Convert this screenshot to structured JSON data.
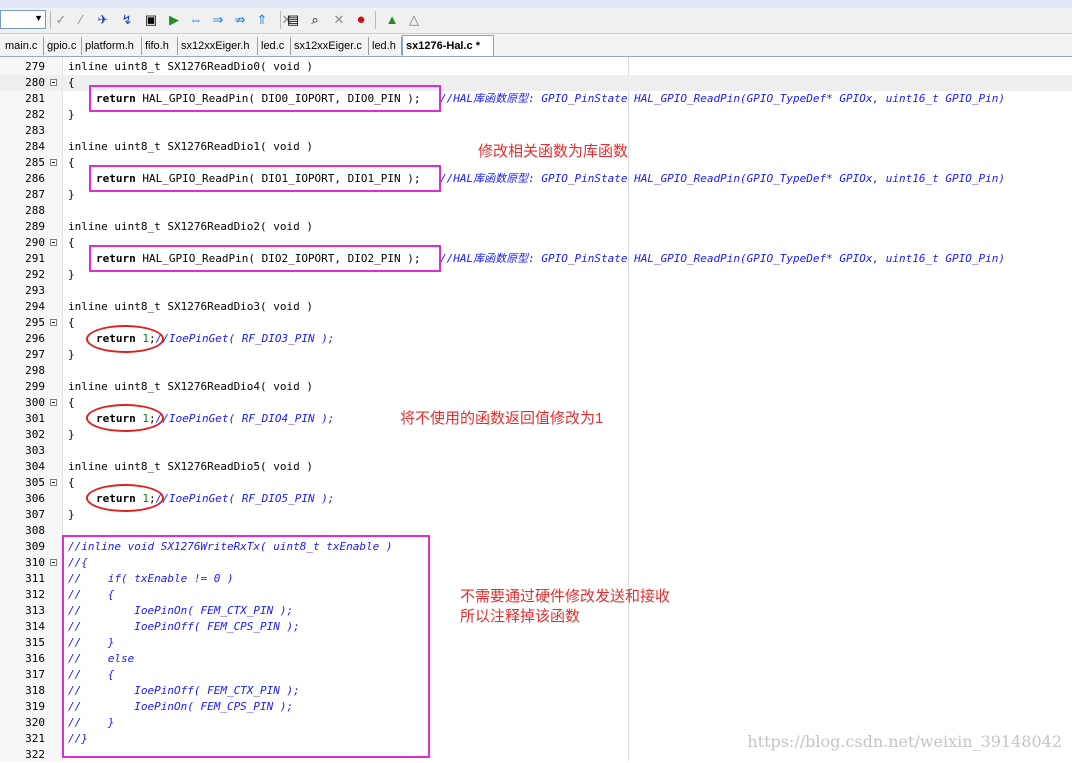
{
  "toolbar": {
    "icons": [
      "pointer-icon",
      "wand-icon",
      "bookmark-icon",
      "bookmark-next-icon",
      "bookmark-clear-icon",
      "build-icon",
      "debug-icon",
      "step-icon",
      "step-over-icon",
      "step-out-icon",
      "step-back-icon",
      "text-icon",
      "find-icon",
      "stop-icon",
      "run-icon",
      "run-to-icon"
    ]
  },
  "tabs": [
    "main.c",
    "gpio.c",
    "platform.h",
    "fifo.h",
    "sx12xxEiger.h",
    "led.c",
    "sx12xxEiger.c",
    "led.h",
    "sx1276-Hal.c *"
  ],
  "active_tab": "sx1276-Hal.c *",
  "code": {
    "l279": "inline uint8_t SX1276ReadDio0( void )",
    "l280": "{",
    "l281": "return HAL_GPIO_ReadPin( DIO0_IOPORT, DIO0_PIN );",
    "l281c": "//HAL库函数原型: GPIO_PinState HAL_GPIO_ReadPin(GPIO_TypeDef* GPIOx, uint16_t GPIO_Pin)",
    "l282": "}",
    "l284": "inline uint8_t SX1276ReadDio1( void )",
    "l285": "{",
    "l286": "return HAL_GPIO_ReadPin( DIO1_IOPORT, DIO1_PIN );",
    "l286c": "//HAL库函数原型: GPIO_PinState HAL_GPIO_ReadPin(GPIO_TypeDef* GPIOx, uint16_t GPIO_Pin)",
    "l287": "}",
    "l289": "inline uint8_t SX1276ReadDio2( void )",
    "l290": "{",
    "l291": "return HAL_GPIO_ReadPin( DIO2_IOPORT, DIO2_PIN );",
    "l291c": "//HAL库函数原型: GPIO_PinState HAL_GPIO_ReadPin(GPIO_TypeDef* GPIOx, uint16_t GPIO_Pin)",
    "l292": "}",
    "l294": "inline uint8_t SX1276ReadDio3( void )",
    "l295": "{",
    "l296c": "//IoePinGet( RF_DIO3_PIN );",
    "l297": "}",
    "l299": "inline uint8_t SX1276ReadDio4( void )",
    "l300": "{",
    "l301c": "//IoePinGet( RF_DIO4_PIN );",
    "l302": "}",
    "l304": "inline uint8_t SX1276ReadDio5( void )",
    "l305": "{",
    "l306c": "//IoePinGet( RF_DIO5_PIN );",
    "l307": "}",
    "l309": "//inline void SX1276WriteRxTx( uint8_t txEnable )",
    "l310": "//{",
    "l311": "//    if( txEnable != 0 )",
    "l312": "//    {",
    "l313": "//        IoePinOn( FEM_CTX_PIN );",
    "l314": "//        IoePinOff( FEM_CPS_PIN );",
    "l315": "//    }",
    "l316": "//    else",
    "l317": "//    {",
    "l318": "//        IoePinOff( FEM_CTX_PIN );",
    "l319": "//        IoePinOn( FEM_CPS_PIN );",
    "l320": "//    }",
    "l321": "//}",
    "return_kw": "return",
    "one": "1",
    "semi": ";"
  },
  "line_numbers": [
    "279",
    "280",
    "281",
    "282",
    "283",
    "284",
    "285",
    "286",
    "287",
    "288",
    "289",
    "290",
    "291",
    "292",
    "293",
    "294",
    "295",
    "296",
    "297",
    "298",
    "299",
    "300",
    "301",
    "302",
    "303",
    "304",
    "305",
    "306",
    "307",
    "308",
    "309",
    "310",
    "311",
    "312",
    "313",
    "314",
    "315",
    "316",
    "317",
    "318",
    "319",
    "320",
    "321",
    "322"
  ],
  "annotations": {
    "note1": "修改相关函数为库函数",
    "note2": "将不使用的函数返回值修改为1",
    "note3a": "不需要通过硬件修改发送和接收",
    "note3b": "所以注释掉该函数"
  },
  "watermark": "https://blog.csdn.net/weixin_39148042",
  "colors": {
    "box": "#e22ad6",
    "oval": "#e02020",
    "note": "#e03030",
    "comment": "#1a1aff",
    "number": "#008000"
  }
}
